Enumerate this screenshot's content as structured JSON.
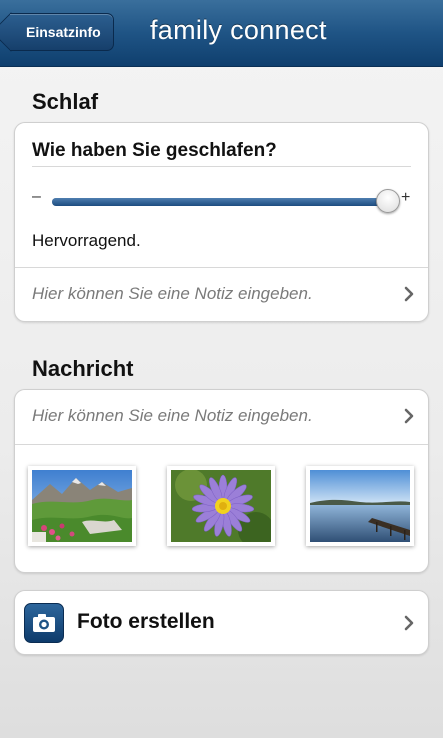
{
  "navbar": {
    "back_label": "Einsatzinfo",
    "title": "family connect"
  },
  "sleep": {
    "section_title": "Schlaf",
    "question": "Wie haben Sie geschlafen?",
    "slider_min_label": "–",
    "slider_max_label": "+",
    "slider_value": 1.0,
    "rating_text": "Hervorragend.",
    "note_placeholder": "Hier können Sie eine Notiz eingeben."
  },
  "message": {
    "section_title": "Nachricht",
    "note_placeholder": "Hier können Sie eine Notiz eingeben.",
    "photos": [
      {
        "subject": "alpine meadow with flowers and mountains"
      },
      {
        "subject": "purple aster flower"
      },
      {
        "subject": "lake with wooden jetty"
      }
    ]
  },
  "photo_action": {
    "label": "Foto erstellen",
    "icon": "camera-icon"
  },
  "colors": {
    "navbar": "#1f5485",
    "slider_fill": "#2f5f92",
    "placeholder": "#7a7a7a"
  }
}
